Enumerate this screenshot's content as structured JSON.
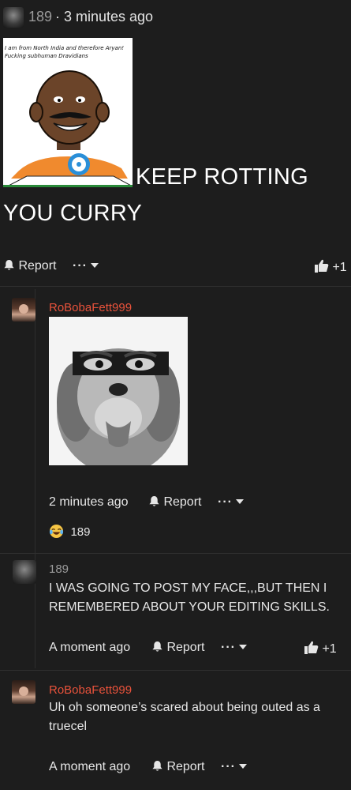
{
  "post": {
    "username": "189",
    "time": "· 3 minutes ago",
    "meme_caption": "I am from North India and therefore Aryan! Fucking subhuman Dravidians",
    "body_line1": "KEEP ROTTING",
    "body_line2": "YOU CURRY",
    "report_label": "Report",
    "more_label": "···",
    "like_count": "+1"
  },
  "replies": [
    {
      "username": "RoBobaFett999",
      "time": "2 minutes ago",
      "report_label": "Report",
      "more_label": "···",
      "reaction_count": "189"
    },
    {
      "username": "189",
      "text_line1": "I WAS GOING TO POST MY FACE,,,BUT THEN I",
      "text_line2": "REMEMBERED ABOUT YOUR EDITING SKILLS.",
      "time": "A moment ago",
      "report_label": "Report",
      "more_label": "···",
      "like_count": "+1"
    },
    {
      "username": "RoBobaFett999",
      "text_line1": "Uh oh someone’s scared about being outed as a",
      "text_line2": "truecel",
      "time": "A moment ago",
      "report_label": "Report",
      "more_label": "···"
    }
  ]
}
